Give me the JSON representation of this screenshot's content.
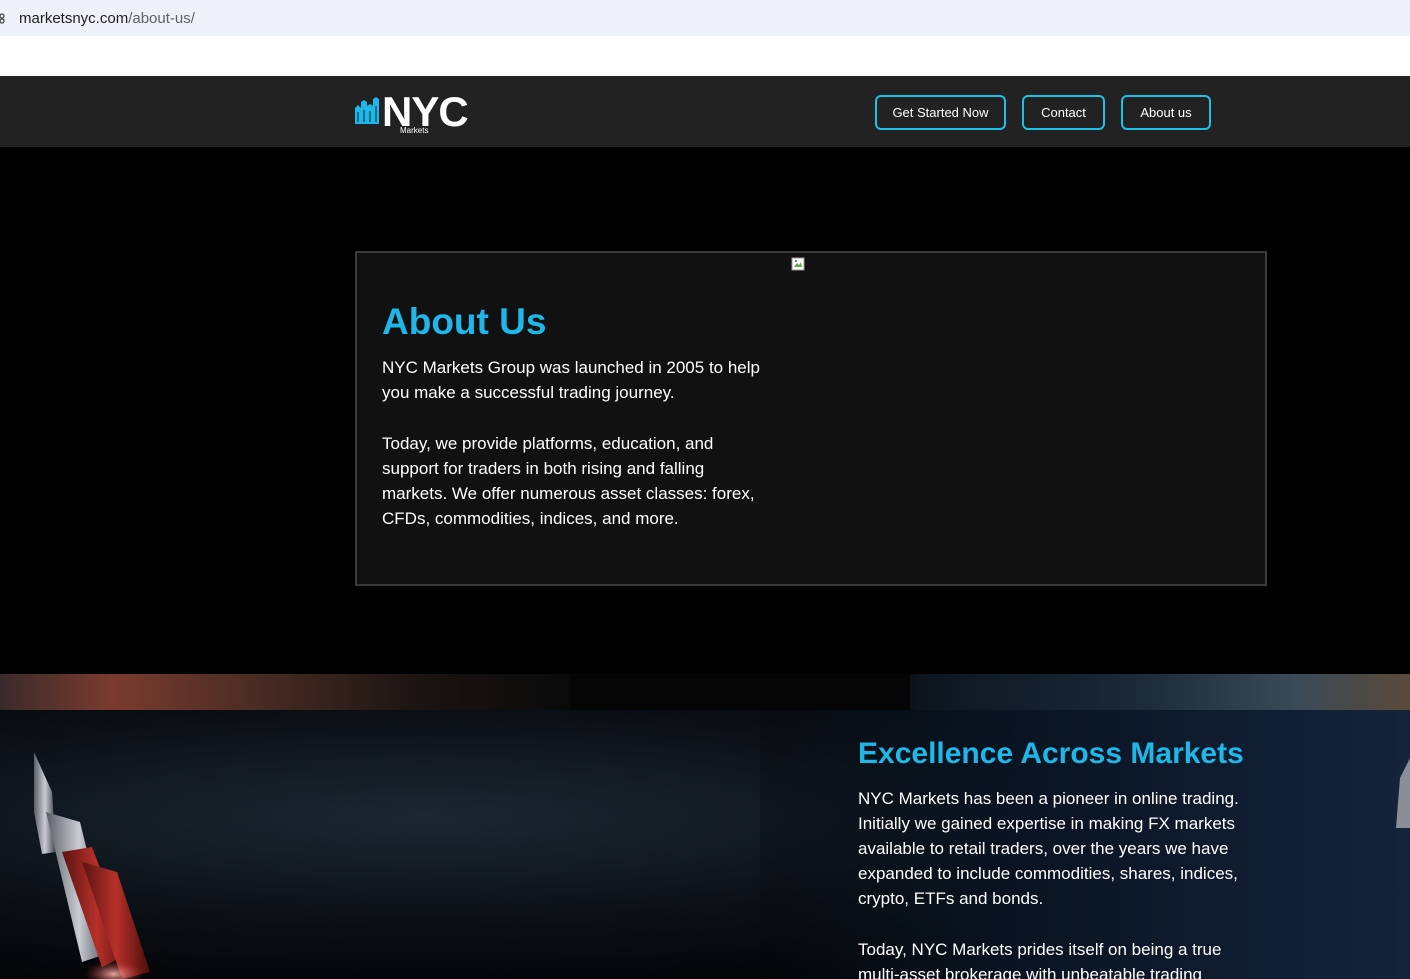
{
  "browser": {
    "url_host": "marketsnyc.com",
    "url_path": "/about-us/"
  },
  "header": {
    "logo_word": "NYC",
    "logo_sub": "Markets",
    "nav": [
      {
        "label": "Get Started Now"
      },
      {
        "label": "Contact"
      },
      {
        "label": "About us"
      }
    ]
  },
  "about": {
    "title": "About Us",
    "paragraph_1": "NYC Markets Group was launched in 2005 to help you make a successful trading journey.",
    "paragraph_2": "Today, we provide platforms, education, and support for traders in both rising and falling markets. We offer numerous asset classes: forex, CFDs, commodities, indices, and more."
  },
  "excellence": {
    "title": "Excellence Across Markets",
    "paragraph_1": "NYC Markets has been a pioneer in online trading. Initially we gained expertise in making FX markets available to retail traders, over the years we have expanded to include commodities, shares, indices, crypto, ETFs and bonds.",
    "paragraph_2": "Today, NYC Markets  prides itself on being a true multi-asset brokerage with unbeatable trading"
  },
  "colors": {
    "accent": "#1fb6e8",
    "header_bg": "#222222",
    "button_border": "#1ec0e6"
  }
}
